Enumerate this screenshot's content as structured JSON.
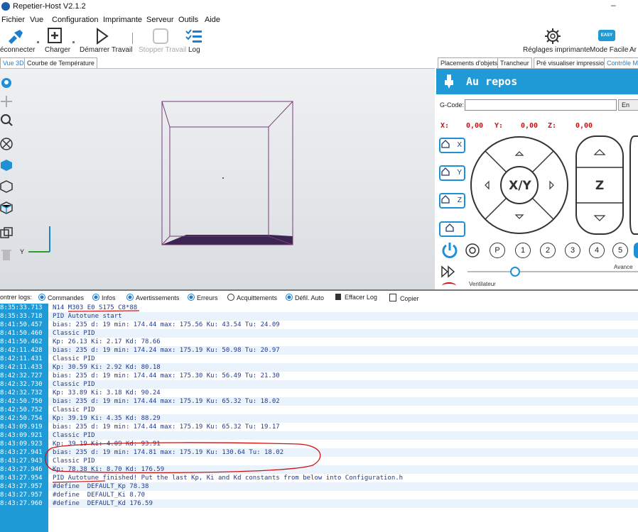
{
  "window": {
    "title": "Repetier-Host V2.1.2",
    "minimize": "–"
  },
  "menu": [
    "Fichier",
    "Vue",
    "Configuration",
    "Imprimante",
    "Serveur",
    "Outils",
    "Aide"
  ],
  "toolbar": {
    "connect": "éconnecter",
    "load": "Charger",
    "start": "Démarrer Travail",
    "stop": "Stopper Travail",
    "log": "Log",
    "printer_settings": "Réglages imprimante",
    "easy_mode": "Mode Facile",
    "easy_badge": "EASY",
    "extra": "Ar"
  },
  "left_tabs": [
    "Vue 3D",
    "Courbe de Température"
  ],
  "right_tabs": [
    "Placements d'objets",
    "Trancheur",
    "Pré visualiser impression",
    "Contrôle Ma"
  ],
  "control": {
    "status": "Au repos",
    "gcode_label": "G-Code:",
    "gcode_value": "",
    "send": "En",
    "x_label": "X:",
    "x_value": "0,00",
    "y_label": "Y:",
    "y_value": "0,00",
    "z_label": "Z:",
    "z_value": "0,00",
    "home_x": "X",
    "home_y": "Y",
    "home_z": "Z",
    "jog_xy": "X/Y",
    "jog_z": "Z",
    "extruders": [
      "P",
      "1",
      "2",
      "3",
      "4",
      "5"
    ],
    "feed_label": "Avance",
    "fan_label": "Ventilateur"
  },
  "log_toolbar": {
    "show_logs": "ontrer logs:",
    "commands": "Commandes",
    "infos": "Infos",
    "warnings": "Avertissements",
    "errors": "Erreurs",
    "acks": "Acquittements",
    "autoscroll": "Défil. Auto",
    "clear": "Effacer Log",
    "copy": "Copier"
  },
  "colors": {
    "accent": "#1e9ad6",
    "log_text": "#1f3a93",
    "coord": "#d01010",
    "annotation": "#d01010"
  },
  "log": [
    {
      "time": "8:35:33.713",
      "msg": "N14 M303 E0 S175 C8*88"
    },
    {
      "time": "8:35:33.718",
      "msg": "PID Autotune start"
    },
    {
      "time": "8:41:50.457",
      "msg": "bias: 235 d: 19 min: 174.44 max: 175.56 Ku: 43.54 Tu: 24.09"
    },
    {
      "time": "8:41:50.460",
      "msg": "Classic PID"
    },
    {
      "time": "8:41:50.462",
      "msg": "Kp: 26.13 Ki: 2.17 Kd: 78.66"
    },
    {
      "time": "8:42:11.428",
      "msg": "bias: 235 d: 19 min: 174.24 max: 175.19 Ku: 50.98 Tu: 20.97"
    },
    {
      "time": "8:42:11.431",
      "msg": "Classic PID"
    },
    {
      "time": "8:42:11.433",
      "msg": "Kp: 30.59 Ki: 2.92 Kd: 80.18"
    },
    {
      "time": "8:42:32.727",
      "msg": "bias: 235 d: 19 min: 174.44 max: 175.30 Ku: 56.49 Tu: 21.30"
    },
    {
      "time": "8:42:32.730",
      "msg": "Classic PID"
    },
    {
      "time": "8:42:32.732",
      "msg": "Kp: 33.89 Ki: 3.18 Kd: 90.24"
    },
    {
      "time": "8:42:50.750",
      "msg": "bias: 235 d: 19 min: 174.44 max: 175.19 Ku: 65.32 Tu: 18.02"
    },
    {
      "time": "8:42:50.752",
      "msg": "Classic PID"
    },
    {
      "time": "8:42:50.754",
      "msg": "Kp: 39.19 Ki: 4.35 Kd: 88.29"
    },
    {
      "time": "8:43:09.919",
      "msg": "bias: 235 d: 19 min: 174.44 max: 175.19 Ku: 65.32 Tu: 19.17"
    },
    {
      "time": "8:43:09.921",
      "msg": "Classic PID"
    },
    {
      "time": "8:43:09.923",
      "msg": "Kp: 39.19 Ki: 4.09 Kd: 93.91"
    },
    {
      "time": "8:43:27.941",
      "msg": "bias: 235 d: 19 min: 174.81 max: 175.19 Ku: 130.64 Tu: 18.02"
    },
    {
      "time": "8:43:27.943",
      "msg": "Classic PID"
    },
    {
      "time": "8:43:27.946",
      "msg": "Kp: 78.38 Ki: 8.70 Kd: 176.59"
    },
    {
      "time": "8:43:27.954",
      "msg": "PID Autotune finished! Put the last Kp, Ki and Kd constants from below into Configuration.h"
    },
    {
      "time": "8:43:27.957",
      "msg": "#define  DEFAULT_Kp 78.38"
    },
    {
      "time": "8:43:27.957",
      "msg": "#define  DEFAULT_Ki 8.70"
    },
    {
      "time": "8:43:27.960",
      "msg": "#define  DEFAULT_Kd 176.59"
    }
  ]
}
